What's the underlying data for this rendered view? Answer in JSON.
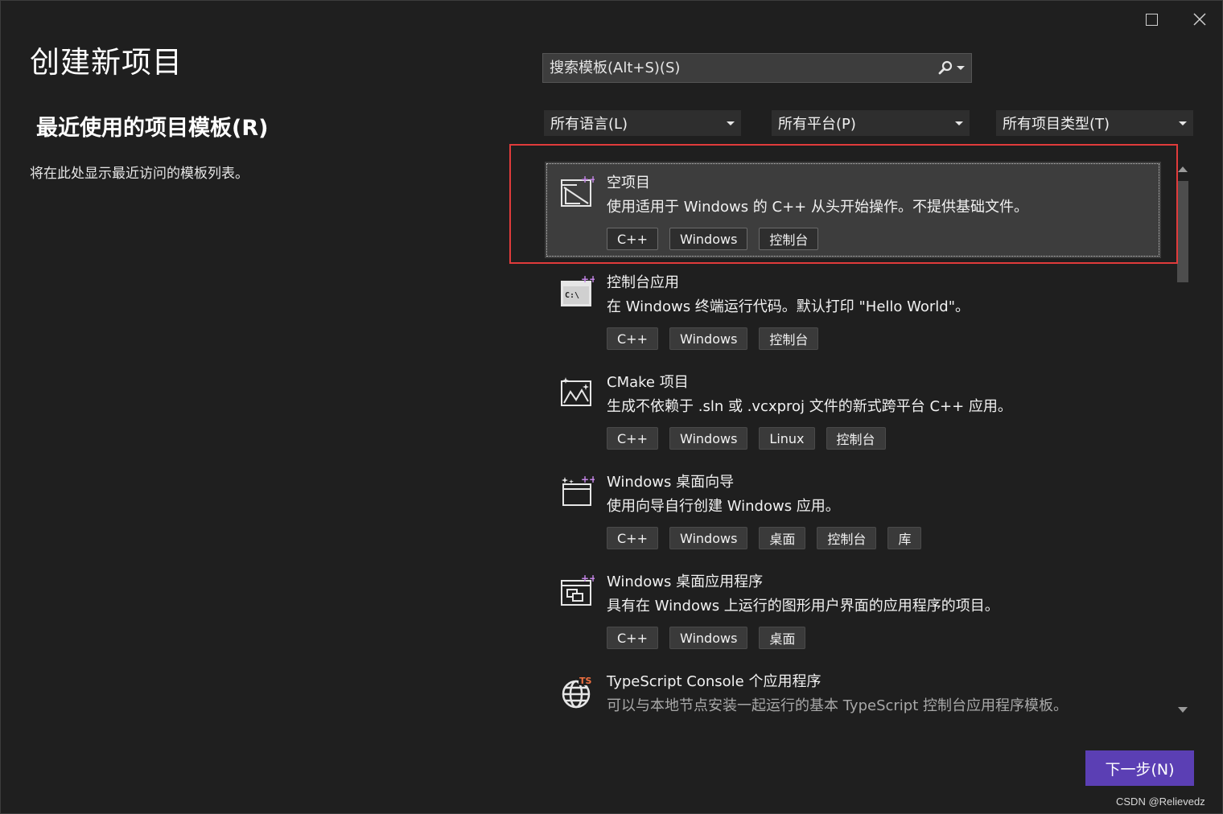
{
  "window": {
    "maximize_icon": "maximize-icon",
    "close_icon": "close-icon"
  },
  "page_title": "创建新项目",
  "recent": {
    "title": "最近使用的项目模板(R)",
    "description": "将在此处显示最近访问的模板列表。"
  },
  "search": {
    "placeholder": "搜索模板(Alt+S)(S)",
    "icon": "search-icon"
  },
  "filters": {
    "language": "所有语言(L)",
    "platform": "所有平台(P)",
    "project_type": "所有项目类型(T)"
  },
  "templates": [
    {
      "name": "空项目",
      "description": "使用适用于 Windows 的 C++ 从头开始操作。不提供基础文件。",
      "tags": [
        "C++",
        "Windows",
        "控制台"
      ],
      "icon": "empty-project-icon",
      "selected": true
    },
    {
      "name": "控制台应用",
      "description": "在 Windows 终端运行代码。默认打印 \"Hello World\"。",
      "tags": [
        "C++",
        "Windows",
        "控制台"
      ],
      "icon": "console-app-icon"
    },
    {
      "name": "CMake 项目",
      "description": "生成不依赖于 .sln 或 .vcxproj 文件的新式跨平台 C++ 应用。",
      "tags": [
        "C++",
        "Windows",
        "Linux",
        "控制台"
      ],
      "icon": "cmake-project-icon"
    },
    {
      "name": "Windows 桌面向导",
      "description": "使用向导自行创建 Windows 应用。",
      "tags": [
        "C++",
        "Windows",
        "桌面",
        "控制台",
        "库"
      ],
      "icon": "desktop-wizard-icon"
    },
    {
      "name": "Windows 桌面应用程序",
      "description": "具有在 Windows 上运行的图形用户界面的应用程序的项目。",
      "tags": [
        "C++",
        "Windows",
        "桌面"
      ],
      "icon": "desktop-app-icon"
    },
    {
      "name": "TypeScript Console 个应用程序",
      "description": "可以与本地节点安装一起运行的基本 TypeScript 控制台应用程序模板。",
      "tags": [],
      "icon": "typescript-console-icon",
      "badge": "TS"
    }
  ],
  "next_button": "下一步(N)",
  "watermark": "CSDN @Relievedz",
  "colors": {
    "accent": "#5b3fb4",
    "highlight": "#e03b3b",
    "background": "#1f1f1f",
    "plus_badge": "#c586e8"
  }
}
